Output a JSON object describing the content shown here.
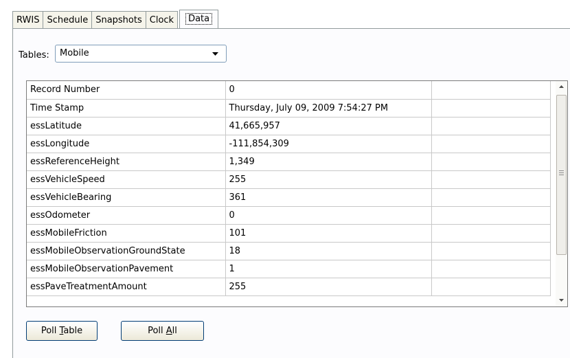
{
  "tabs": [
    {
      "label": "RWIS"
    },
    {
      "label": "Schedule"
    },
    {
      "label": "Snapshots"
    },
    {
      "label": "Clock"
    },
    {
      "label": "Data"
    }
  ],
  "active_tab": "Data",
  "tables": {
    "label": "Tables:",
    "selected": "Mobile"
  },
  "data_table": {
    "rows": [
      {
        "name": "Record Number",
        "value": "0"
      },
      {
        "name": "Time Stamp",
        "value": "Thursday, July 09, 2009 7:54:27 PM"
      },
      {
        "name": "essLatitude",
        "value": "41,665,957"
      },
      {
        "name": "essLongitude",
        "value": "-111,854,309"
      },
      {
        "name": "essReferenceHeight",
        "value": "1,349"
      },
      {
        "name": "essVehicleSpeed",
        "value": "255"
      },
      {
        "name": "essVehicleBearing",
        "value": "361"
      },
      {
        "name": "essOdometer",
        "value": "0"
      },
      {
        "name": "essMobileFriction",
        "value": "101"
      },
      {
        "name": "essMobileObservationGroundState",
        "value": "18"
      },
      {
        "name": "essMobileObservationPavement",
        "value": "1"
      },
      {
        "name": "essPaveTreatmentAmount",
        "value": "255"
      }
    ]
  },
  "buttons": {
    "poll_table": {
      "before": "Poll ",
      "mnemonic": "T",
      "after": "able"
    },
    "poll_all": {
      "before": "Poll ",
      "mnemonic": "A",
      "after": "ll"
    }
  },
  "colors": {
    "window_bg": "#fcfcfe",
    "tab_border": "#919b9c",
    "button_border": "#003c74"
  }
}
